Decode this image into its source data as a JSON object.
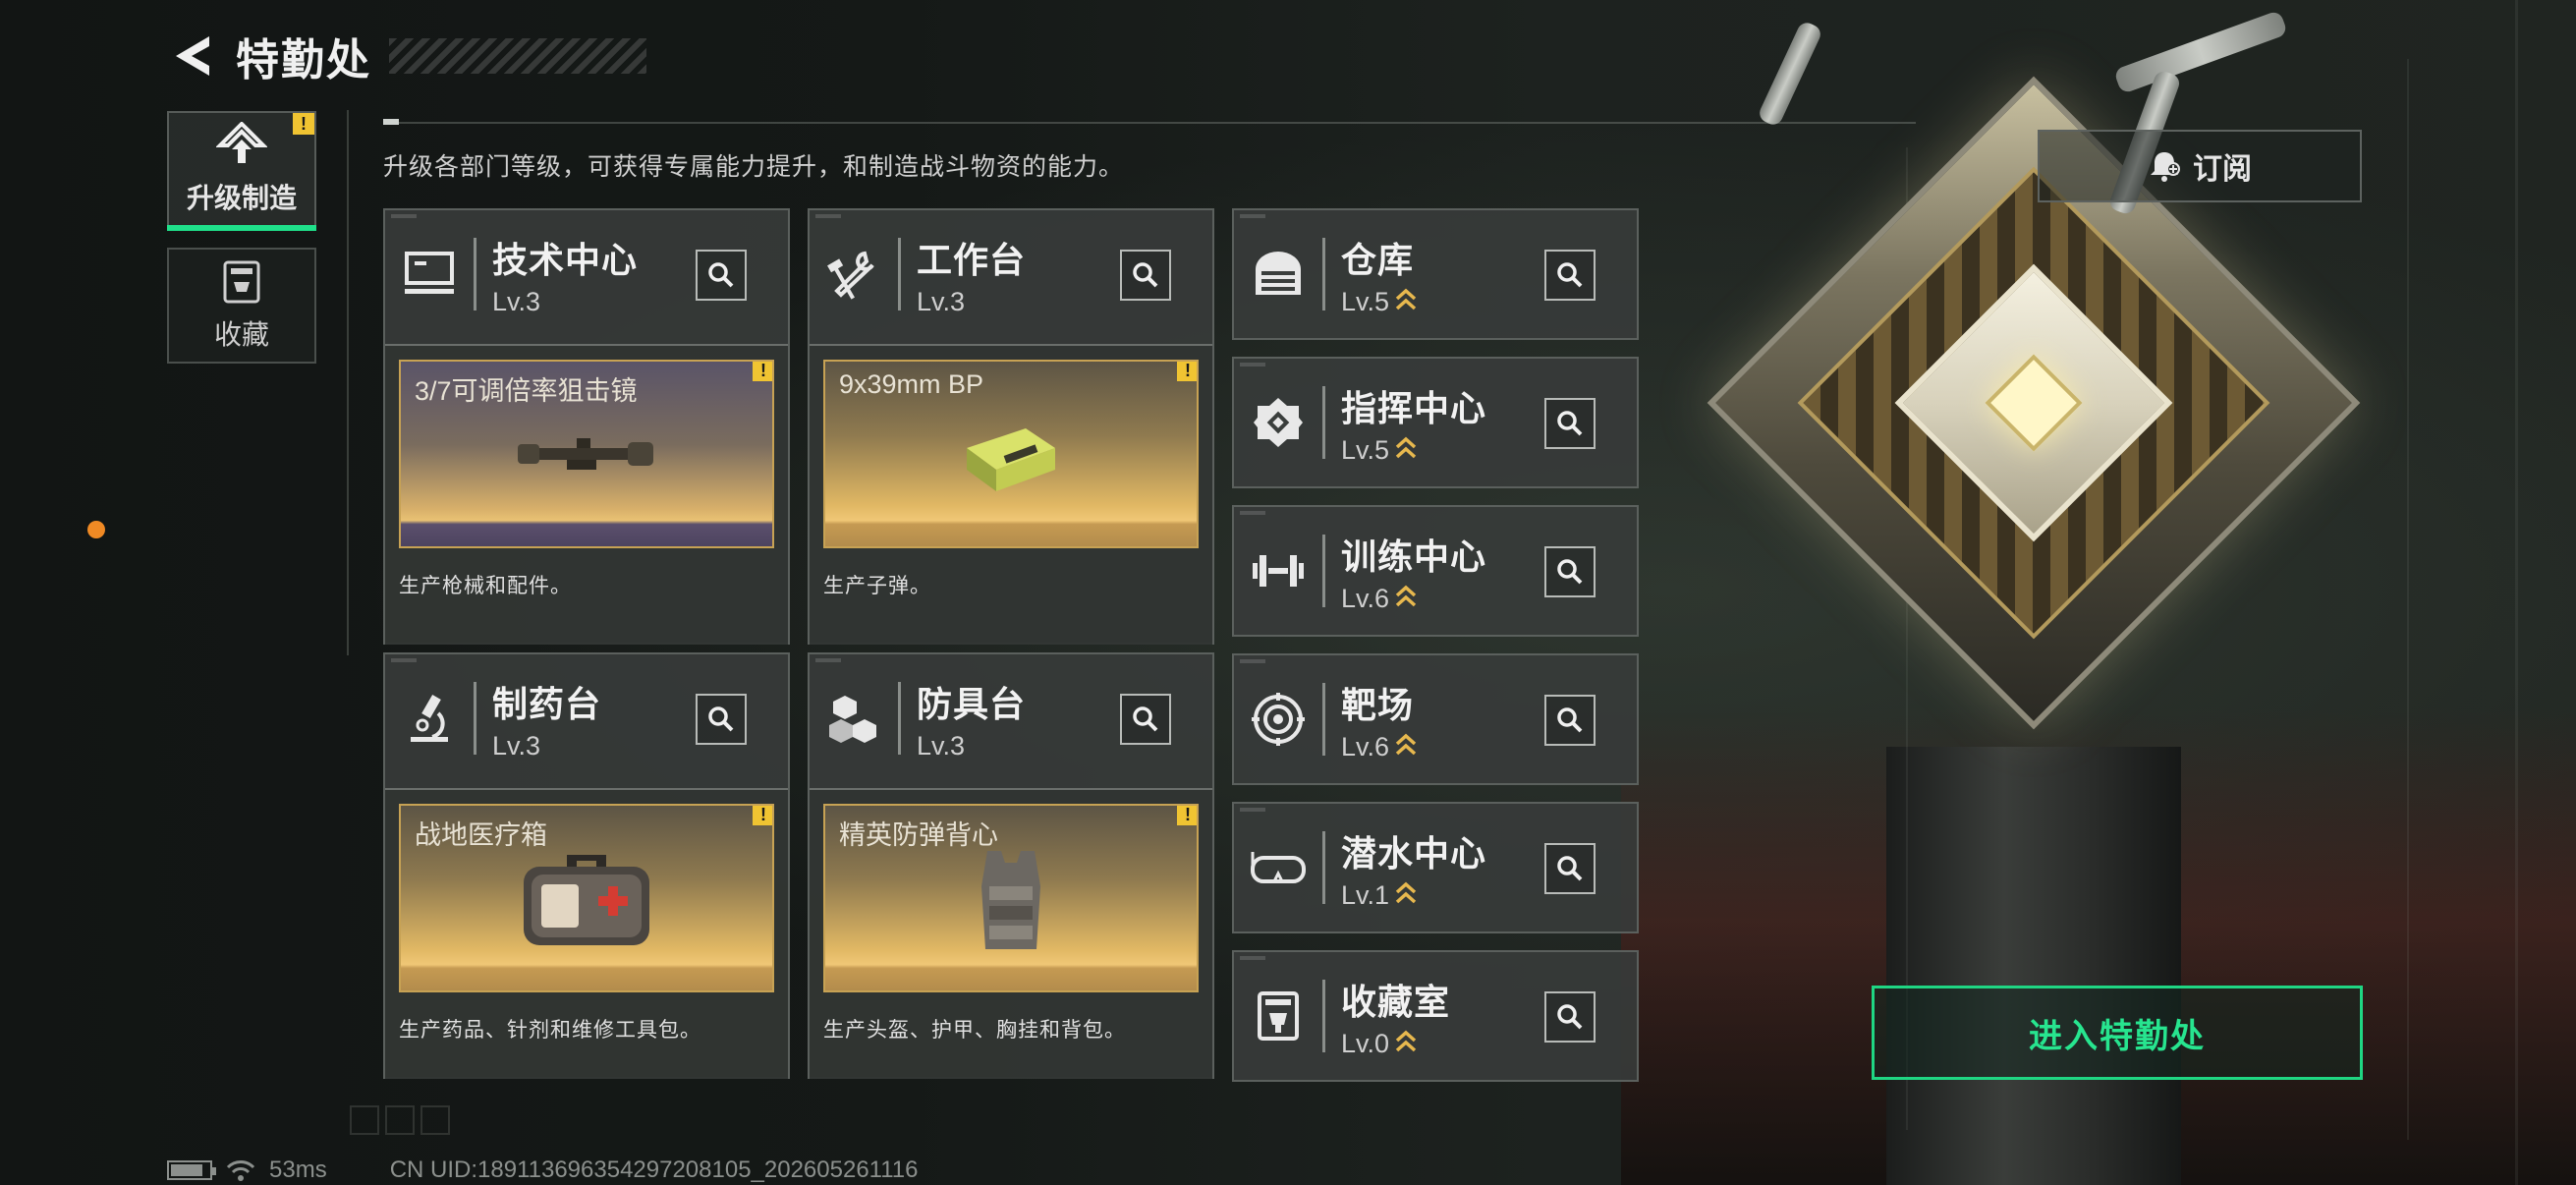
{
  "header": {
    "title": "特勤处"
  },
  "nav": [
    {
      "label": "升级制造",
      "active": true,
      "warning": "!"
    },
    {
      "label": "收藏",
      "active": false
    }
  ],
  "description": "升级各部门等级，可获得专属能力提升，和制造战斗物资的能力。",
  "departments": {
    "tech_center": {
      "name": "技术中心",
      "level": "Lv.3",
      "production": {
        "item": "3/7可调倍率狙击镜",
        "desc": "生产枪械和配件。",
        "warning": "!"
      }
    },
    "workbench": {
      "name": "工作台",
      "level": "Lv.3",
      "production": {
        "item": "9x39mm BP",
        "desc": "生产子弹。",
        "warning": "!"
      }
    },
    "pharmacy": {
      "name": "制药台",
      "level": "Lv.3",
      "production": {
        "item": "战地医疗箱",
        "desc": "生产药品、针剂和维修工具包。",
        "warning": "!"
      }
    },
    "armor_bench": {
      "name": "防具台",
      "level": "Lv.3",
      "production": {
        "item": "精英防弹背心",
        "desc": "生产头盔、护甲、胸挂和背包。",
        "warning": "!"
      }
    },
    "warehouse": {
      "name": "仓库",
      "level": "Lv.5"
    },
    "command_center": {
      "name": "指挥中心",
      "level": "Lv.5"
    },
    "training_center": {
      "name": "训练中心",
      "level": "Lv.6"
    },
    "shooting_range": {
      "name": "靶场",
      "level": "Lv.6"
    },
    "diving_center": {
      "name": "潜水中心",
      "level": "Lv.1"
    },
    "collection_room": {
      "name": "收藏室",
      "level": "Lv.0"
    }
  },
  "subscribe": {
    "label": "订阅"
  },
  "enter_button": {
    "label": "进入特勤处"
  },
  "status": {
    "ping": "53ms",
    "uid": "CN UID:18911369635429720810​5_202605261116"
  },
  "colors": {
    "accent": "#1fe08a",
    "warning": "#f0c432",
    "gold": "#c7a254"
  }
}
